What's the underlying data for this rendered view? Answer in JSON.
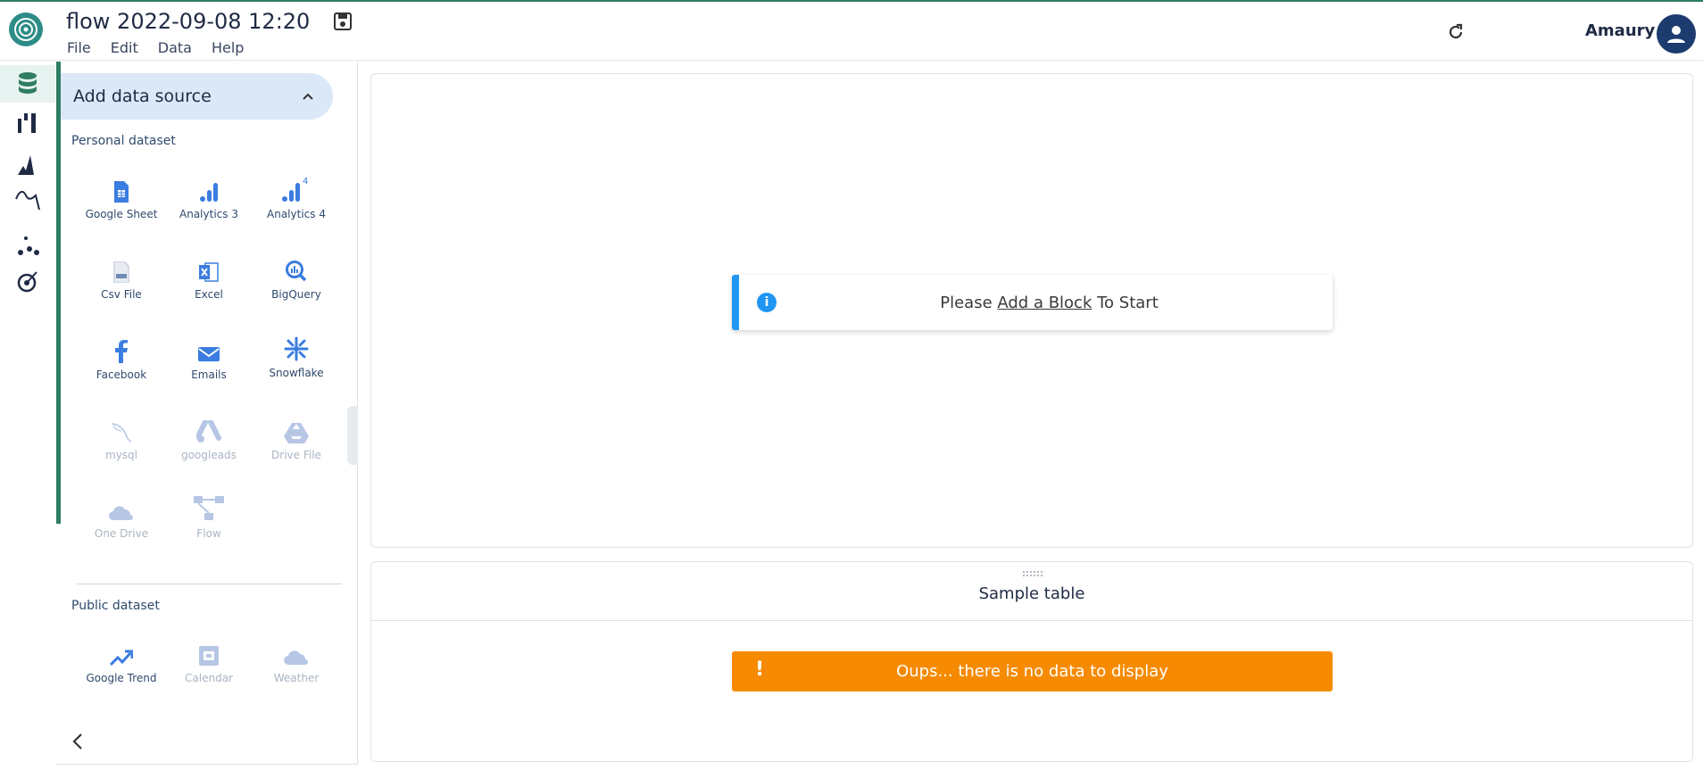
{
  "header": {
    "title": "flow 2022-09-08 12:20",
    "menu": [
      "File",
      "Edit",
      "Data",
      "Help"
    ],
    "user_name": "Amaury"
  },
  "rail": {
    "icons": [
      "database-icon",
      "bars-icon",
      "peak-chart-icon",
      "curve-icon",
      "scatter-icon",
      "target-icon"
    ]
  },
  "sidebar": {
    "section_title": "Add data source",
    "personal_label": "Personal dataset",
    "personal_sources": [
      {
        "label": "Google Sheet",
        "icon": "google-sheet-icon",
        "enabled": true
      },
      {
        "label": "Analytics 3",
        "icon": "analytics-icon",
        "enabled": true
      },
      {
        "label": "Analytics 4",
        "icon": "analytics-4-icon",
        "enabled": true,
        "badge": "4"
      },
      {
        "label": "Csv File",
        "icon": "csv-file-icon",
        "enabled": true
      },
      {
        "label": "Excel",
        "icon": "excel-icon",
        "enabled": true
      },
      {
        "label": "BigQuery",
        "icon": "bigquery-icon",
        "enabled": true
      },
      {
        "label": "Facebook",
        "icon": "facebook-icon",
        "enabled": true
      },
      {
        "label": "Emails",
        "icon": "email-icon",
        "enabled": true
      },
      {
        "label": "Snowflake",
        "icon": "snowflake-icon",
        "enabled": true
      },
      {
        "label": "mysql",
        "icon": "mysql-icon",
        "enabled": false
      },
      {
        "label": "googleads",
        "icon": "google-ads-icon",
        "enabled": false
      },
      {
        "label": "Drive File",
        "icon": "drive-icon",
        "enabled": false
      },
      {
        "label": "One Drive",
        "icon": "cloud-icon",
        "enabled": false
      },
      {
        "label": "Flow",
        "icon": "flow-icon",
        "enabled": false
      }
    ],
    "public_label": "Public dataset",
    "public_sources": [
      {
        "label": "Google Trend",
        "icon": "trend-icon",
        "enabled": true
      },
      {
        "label": "Calendar",
        "icon": "calendar-icon",
        "enabled": false
      },
      {
        "label": "Weather",
        "icon": "weather-icon",
        "enabled": false
      }
    ]
  },
  "canvas": {
    "info_prefix": "Please ",
    "info_link": "Add a Block",
    "info_suffix": " To Start"
  },
  "sample_table": {
    "title": "Sample table",
    "warning_mark": "!",
    "warning": "Oups... there is no data to display"
  },
  "colors": {
    "accent": "#2f7d63",
    "info": "#2196f3",
    "warning": "#f68a00",
    "source_icon": "#3b7de0"
  }
}
